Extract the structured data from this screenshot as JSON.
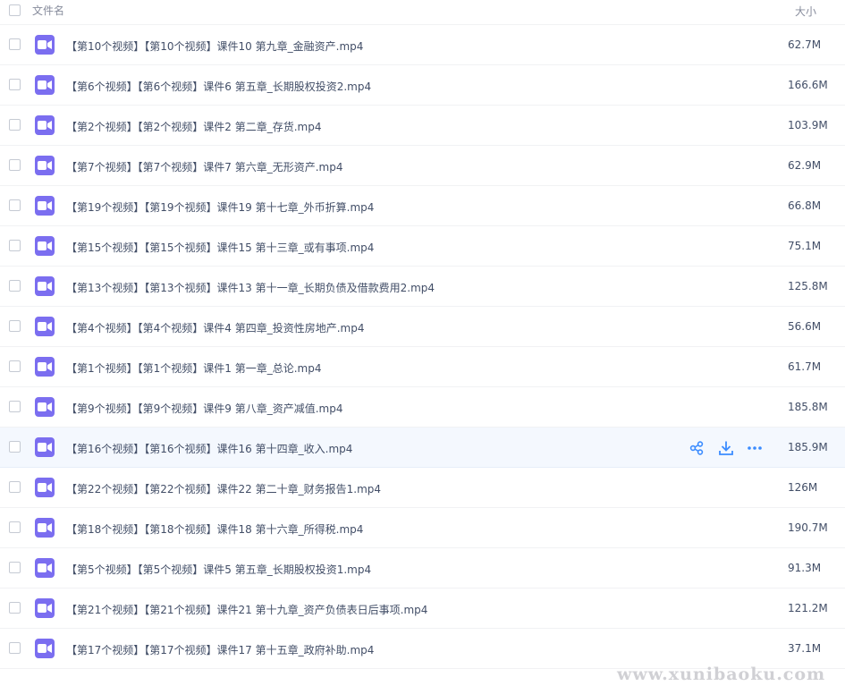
{
  "header": {
    "name_label": "文件名",
    "size_label": "大小"
  },
  "accent_color": "#7b6ef0",
  "action_color": "#3b8cff",
  "files": [
    {
      "name": "【第10个视频】【第10个视频】课件10 第九章_金融资产.mp4",
      "size": "62.7M"
    },
    {
      "name": "【第6个视频】【第6个视频】课件6 第五章_长期股权投资2.mp4",
      "size": "166.6M"
    },
    {
      "name": "【第2个视频】【第2个视频】课件2 第二章_存货.mp4",
      "size": "103.9M"
    },
    {
      "name": "【第7个视频】【第7个视频】课件7 第六章_无形资产.mp4",
      "size": "62.9M"
    },
    {
      "name": "【第19个视频】【第19个视频】课件19 第十七章_外币折算.mp4",
      "size": "66.8M"
    },
    {
      "name": "【第15个视频】【第15个视频】课件15 第十三章_或有事项.mp4",
      "size": "75.1M"
    },
    {
      "name": "【第13个视频】【第13个视频】课件13 第十一章_长期负债及借款费用2.mp4",
      "size": "125.8M"
    },
    {
      "name": "【第4个视频】【第4个视频】课件4 第四章_投资性房地产.mp4",
      "size": "56.6M"
    },
    {
      "name": "【第1个视频】【第1个视频】课件1 第一章_总论.mp4",
      "size": "61.7M"
    },
    {
      "name": "【第9个视频】【第9个视频】课件9 第八章_资产减值.mp4",
      "size": "185.8M"
    },
    {
      "name": "【第16个视频】【第16个视频】课件16 第十四章_收入.mp4",
      "size": "185.9M",
      "hovered": true
    },
    {
      "name": "【第22个视频】【第22个视频】课件22 第二十章_财务报告1.mp4",
      "size": "126M"
    },
    {
      "name": "【第18个视频】【第18个视频】课件18 第十六章_所得税.mp4",
      "size": "190.7M"
    },
    {
      "name": "【第5个视频】【第5个视频】课件5 第五章_长期股权投资1.mp4",
      "size": "91.3M"
    },
    {
      "name": "【第21个视频】【第21个视频】课件21 第十九章_资产负债表日后事项.mp4",
      "size": "121.2M"
    },
    {
      "name": "【第17个视频】【第17个视频】课件17 第十五章_政府补助.mp4",
      "size": "37.1M"
    }
  ],
  "row_actions": {
    "share": "share-icon",
    "download": "download-icon",
    "more": "more-icon"
  },
  "watermark": "www.xunibaoku.com"
}
